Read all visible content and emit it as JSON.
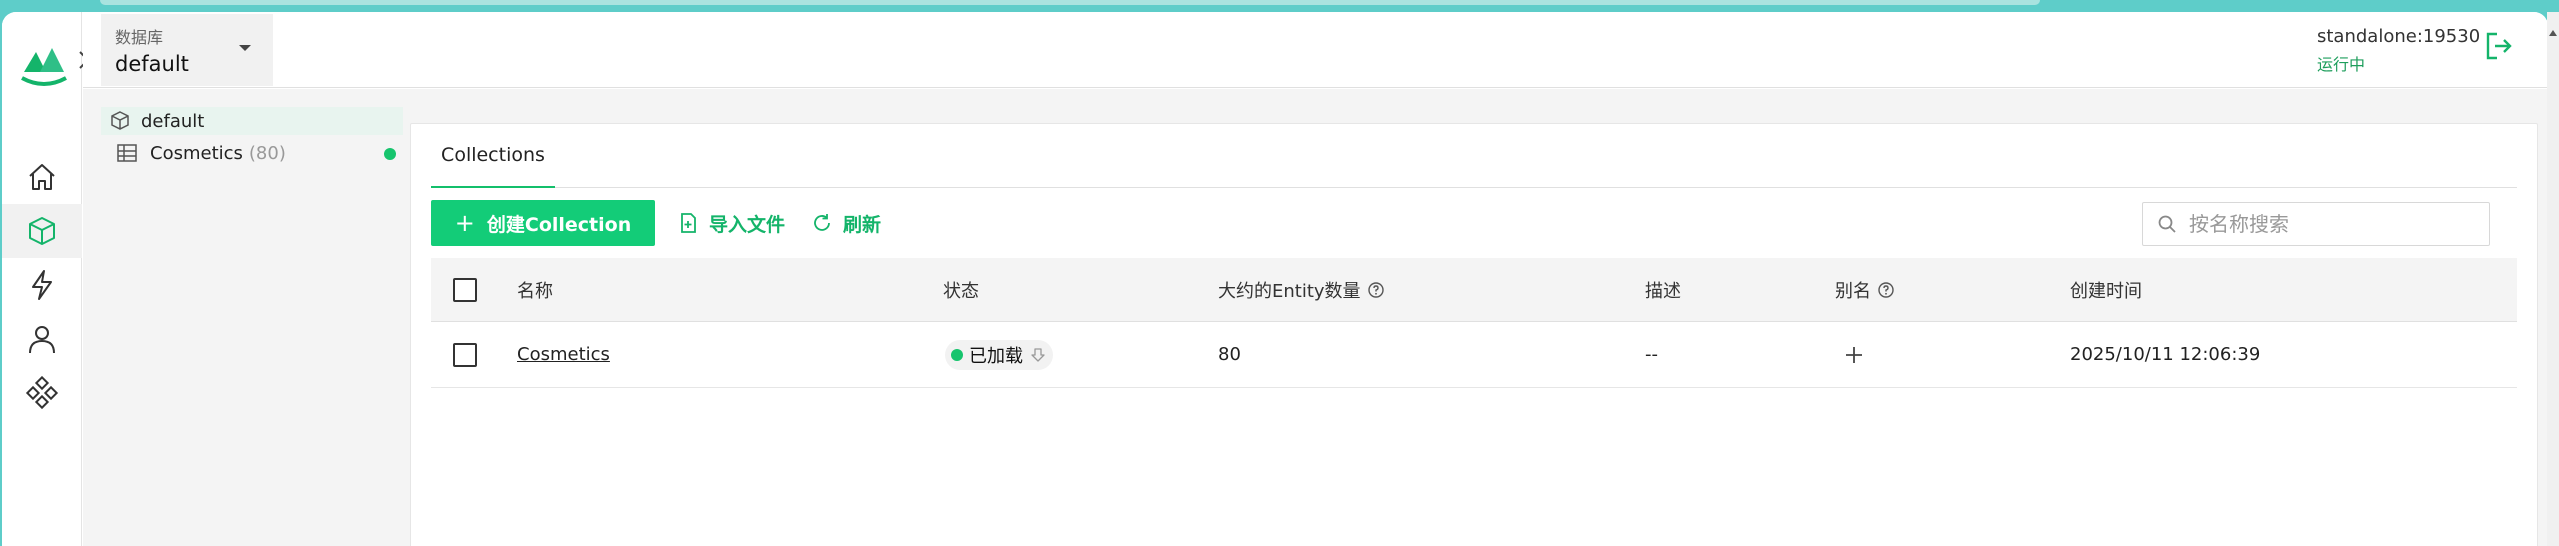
{
  "header": {
    "db_label": "数据库",
    "db_value": "default",
    "server_address": "standalone:19530",
    "server_status": "运行中"
  },
  "nav": {
    "items": [
      "home",
      "database",
      "system",
      "users",
      "plugins"
    ]
  },
  "tree": {
    "database": "default",
    "collections": [
      {
        "name": "Cosmetics",
        "count": "(80)"
      }
    ]
  },
  "tabs": [
    "Collections"
  ],
  "toolbar": {
    "create_plus": "+",
    "create_label": "创建Collection",
    "import_label": "导入文件",
    "refresh_label": "刷新",
    "search_placeholder": "按名称搜索"
  },
  "table": {
    "headers": {
      "name": "名称",
      "status": "状态",
      "entity_count": "大约的Entity数量",
      "description": "描述",
      "alias": "别名",
      "created": "创建时间"
    },
    "rows": [
      {
        "name": "Cosmetics",
        "status": "已加载",
        "entity_count": "80",
        "description": "--",
        "created": "2025/10/11 12:06:39"
      }
    ]
  },
  "colors": {
    "accent": "#13cc78",
    "accent_text": "#14b46a",
    "status_green": "#16c46d",
    "frame": "#5ecdc9"
  },
  "icons": {
    "logo": "milvus-logo-icon",
    "home": "home-icon",
    "database": "cube-icon",
    "system": "lightning-icon",
    "users": "user-icon",
    "plugins": "diamond-grid-icon",
    "logout": "logout-icon",
    "search": "search-icon",
    "import": "file-plus-icon",
    "refresh": "refresh-icon"
  }
}
